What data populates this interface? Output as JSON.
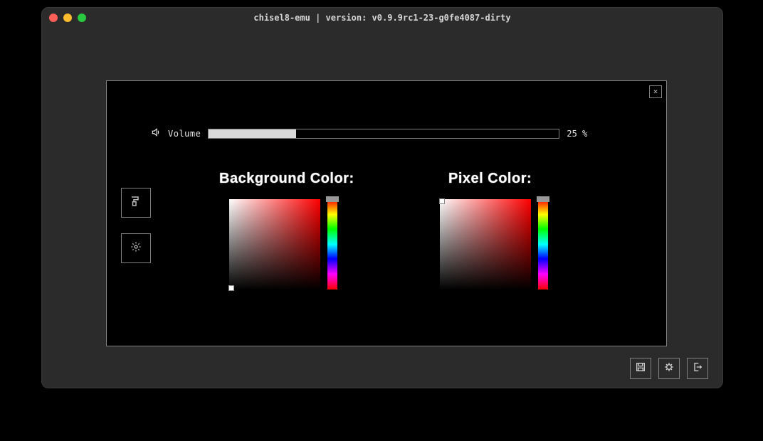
{
  "window": {
    "title": "chisel8-emu | version: v0.9.9rc1-23-g0fe4087-dirty"
  },
  "panel": {
    "close_label": "×",
    "volume": {
      "label": "Volume",
      "value_text": "25 %",
      "percent": 25
    },
    "sidebar": {
      "items": [
        {
          "name": "paint-icon"
        },
        {
          "name": "gear-icon"
        }
      ]
    },
    "background_color": {
      "heading": "Background Color:",
      "hue": 0,
      "sv_handle_x": 0.02,
      "sv_handle_y": 0.98
    },
    "pixel_color": {
      "heading": "Pixel Color:",
      "hue": 0,
      "sv_handle_x": 0.02,
      "sv_handle_y": 0.02
    }
  },
  "footer": {
    "buttons": [
      {
        "name": "save-icon"
      },
      {
        "name": "debug-icon"
      },
      {
        "name": "exit-icon"
      }
    ]
  }
}
